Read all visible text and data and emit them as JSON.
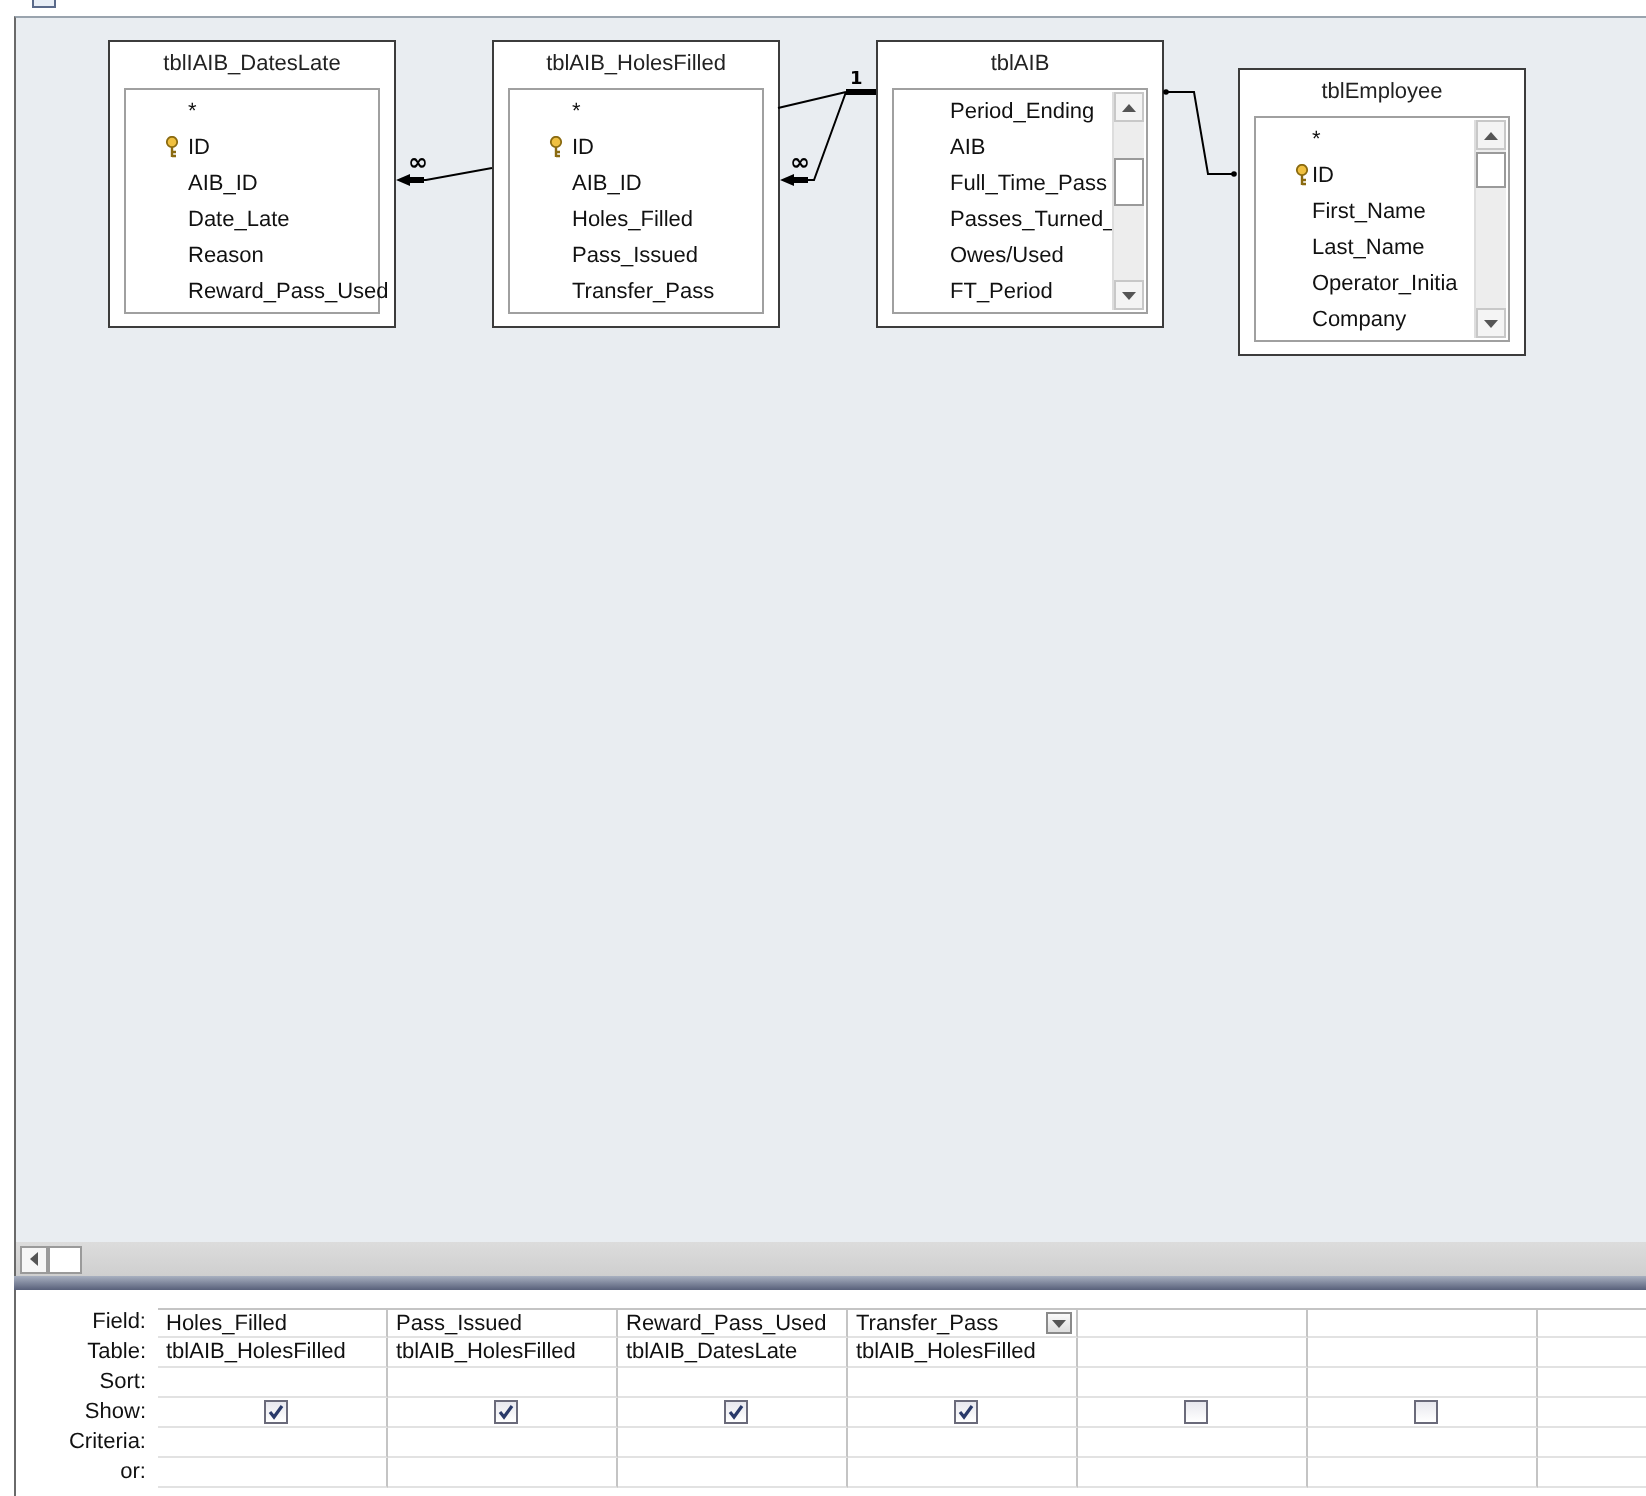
{
  "tables": [
    {
      "name": "tblIAIB_DatesLate",
      "scrollbar": false,
      "fields": [
        {
          "name": "*",
          "primary_key": false
        },
        {
          "name": "ID",
          "primary_key": true
        },
        {
          "name": "AIB_ID",
          "primary_key": false
        },
        {
          "name": "Date_Late",
          "primary_key": false
        },
        {
          "name": "Reason",
          "primary_key": false
        },
        {
          "name": "Reward_Pass_Used",
          "primary_key": false
        }
      ]
    },
    {
      "name": "tblAIB_HolesFilled",
      "scrollbar": false,
      "fields": [
        {
          "name": "*",
          "primary_key": false
        },
        {
          "name": "ID",
          "primary_key": true
        },
        {
          "name": "AIB_ID",
          "primary_key": false
        },
        {
          "name": "Holes_Filled",
          "primary_key": false
        },
        {
          "name": "Pass_Issued",
          "primary_key": false
        },
        {
          "name": "Transfer_Pass",
          "primary_key": false
        }
      ]
    },
    {
      "name": "tblAIB",
      "scrollbar": true,
      "fields": [
        {
          "name": "Period_Ending",
          "primary_key": false
        },
        {
          "name": "AIB",
          "primary_key": false
        },
        {
          "name": "Full_Time_Pass",
          "primary_key": false
        },
        {
          "name": "Passes_Turned_",
          "primary_key": false
        },
        {
          "name": "Owes/Used",
          "primary_key": false
        },
        {
          "name": "FT_Period",
          "primary_key": false
        }
      ]
    },
    {
      "name": "tblEmployee",
      "scrollbar": true,
      "fields": [
        {
          "name": "*",
          "primary_key": false
        },
        {
          "name": "ID",
          "primary_key": true
        },
        {
          "name": "First_Name",
          "primary_key": false
        },
        {
          "name": "Last_Name",
          "primary_key": false
        },
        {
          "name": "Operator_Initia",
          "primary_key": false
        },
        {
          "name": "Company",
          "primary_key": false
        }
      ]
    }
  ],
  "relationships": [
    {
      "kind": "one_to_many",
      "many_label": "∞"
    },
    {
      "kind": "one_to_many",
      "one_label": "1",
      "many_label": "∞"
    },
    {
      "kind": "join"
    }
  ],
  "grid": {
    "row_labels": [
      "Field:",
      "Table:",
      "Sort:",
      "Show:",
      "Criteria:",
      "or:"
    ],
    "columns": [
      {
        "field": "Holes_Filled",
        "table": "tblAIB_HolesFilled",
        "show": true,
        "selected": false
      },
      {
        "field": "Pass_Issued",
        "table": "tblAIB_HolesFilled",
        "show": true,
        "selected": false
      },
      {
        "field": "Reward_Pass_Used",
        "table": "tblAIB_DatesLate",
        "show": true,
        "selected": false
      },
      {
        "field": "Transfer_Pass",
        "table": "tblAIB_HolesFilled",
        "show": true,
        "selected": true
      },
      {
        "show": false,
        "selected": false
      },
      {
        "show": false,
        "selected": false
      },
      {
        "selected": false
      }
    ]
  }
}
